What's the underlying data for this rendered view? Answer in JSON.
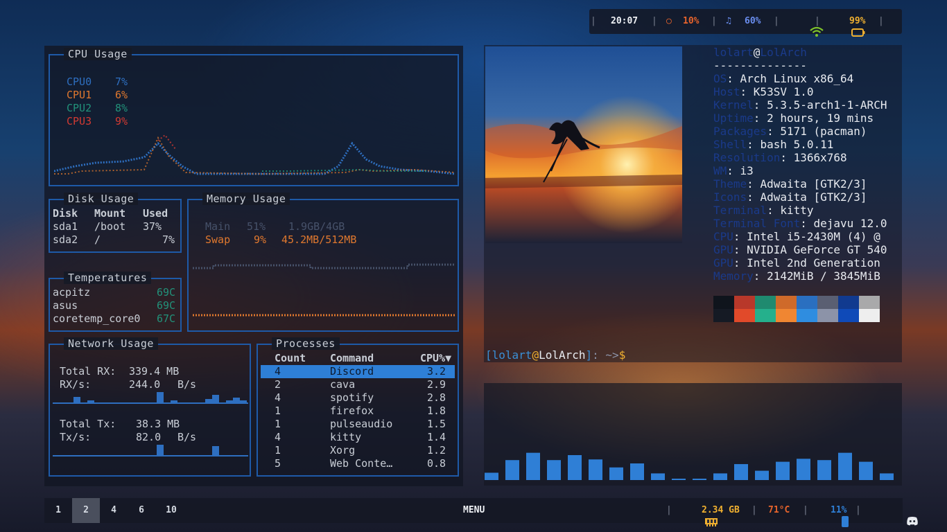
{
  "topbar": {
    "time": "20:07",
    "cpu": "10%",
    "volume": "60%",
    "battery": "99%",
    "sep": "|",
    "colors": {
      "cpu": "#e8642c",
      "volume": "#6a8ef0",
      "wifi": "#7ec32a",
      "battery": "#f0b030"
    }
  },
  "cpu": {
    "title": "CPU Usage",
    "cores": [
      {
        "name": "CPU0",
        "value": "7%",
        "color": "#2e6fc0"
      },
      {
        "name": "CPU1",
        "value": "6%",
        "color": "#e0782e"
      },
      {
        "name": "CPU2",
        "value": "8%",
        "color": "#22927a"
      },
      {
        "name": "CPU3",
        "value": "9%",
        "color": "#d23a32"
      }
    ]
  },
  "disk": {
    "title": "Disk Usage",
    "headers": [
      "Disk",
      "Mount",
      "Used"
    ],
    "rows": [
      [
        "sda1",
        "/boot",
        "37%"
      ],
      [
        "sda2",
        "/",
        "7%"
      ]
    ]
  },
  "temps": {
    "title": "Temperatures",
    "rows": [
      {
        "name": "acpitz",
        "value": "69C"
      },
      {
        "name": "asus",
        "value": "69C"
      },
      {
        "name": "coretemp_core0",
        "value": "67C"
      }
    ]
  },
  "memory": {
    "title": "Memory Usage",
    "main": {
      "label": "Main",
      "pct": "51%",
      "amount": "1.9GB/4GB"
    },
    "swap": {
      "label": "Swap",
      "pct": "9%",
      "amount": "45.2MB/512MB"
    },
    "colors": {
      "main": "#47526a",
      "swap": "#e0782e"
    }
  },
  "network": {
    "title": "Network Usage",
    "total_rx_label": "Total RX:",
    "total_rx": "339.4 MB",
    "rx_rate_label": "RX/s:",
    "rx_rate": "244.0",
    "rx_unit": "B/s",
    "total_tx_label": "Total Tx:",
    "total_tx": "38.3 MB",
    "tx_rate_label": "Tx/s:",
    "tx_rate": "82.0",
    "tx_unit": "B/s"
  },
  "processes": {
    "title": "Processes",
    "headers": {
      "count": "Count",
      "command": "Command",
      "cpu": "CPU%▼"
    },
    "rows": [
      {
        "count": "4",
        "command": "Discord",
        "cpu": "3.2"
      },
      {
        "count": "2",
        "command": "cava",
        "cpu": "2.9"
      },
      {
        "count": "4",
        "command": "spotify",
        "cpu": "2.8"
      },
      {
        "count": "1",
        "command": "firefox",
        "cpu": "1.8"
      },
      {
        "count": "1",
        "command": "pulseaudio",
        "cpu": "1.5"
      },
      {
        "count": "4",
        "command": "kitty",
        "cpu": "1.4"
      },
      {
        "count": "1",
        "command": "Xorg",
        "cpu": "1.2"
      },
      {
        "count": "5",
        "command": "Web Conte…",
        "cpu": "0.8"
      }
    ]
  },
  "neofetch": {
    "user": "lolart",
    "at": "@",
    "host": "LolArch",
    "divider": "--------------",
    "sep": ": ",
    "fields": [
      {
        "label": "OS",
        "value": "Arch Linux x86_64"
      },
      {
        "label": "Host",
        "value": "K53SV 1.0"
      },
      {
        "label": "Kernel",
        "value": "5.3.5-arch1-1-ARCH"
      },
      {
        "label": "Uptime",
        "value": "2 hours, 19 mins"
      },
      {
        "label": "Packages",
        "value": "5171 (pacman)"
      },
      {
        "label": "Shell",
        "value": "bash 5.0.11"
      },
      {
        "label": "Resolution",
        "value": "1366x768"
      },
      {
        "label": "WM",
        "value": "i3"
      },
      {
        "label": "Theme",
        "value": "Adwaita [GTK2/3]"
      },
      {
        "label": "Icons",
        "value": "Adwaita [GTK2/3]"
      },
      {
        "label": "Terminal",
        "value": "kitty"
      },
      {
        "label": "Terminal Font",
        "value": "dejavu 12.0"
      },
      {
        "label": "CPU",
        "value": "Intel i5-2430M (4) @"
      },
      {
        "label": "GPU",
        "value": "NVIDIA GeForce GT 540"
      },
      {
        "label": "GPU",
        "value": "Intel 2nd Generation"
      },
      {
        "label": "Memory",
        "value": "2142MiB / 3845MiB"
      }
    ],
    "palette_top": [
      "#0f141c",
      "#b8382a",
      "#1f8a6f",
      "#cf6a2a",
      "#2a6fc0",
      "#5a5f72",
      "#113a8f",
      "#a9a9aa"
    ],
    "palette_bottom": [
      "#151a24",
      "#e14a2a",
      "#25b08c",
      "#f08632",
      "#2f8de0",
      "#8c93a8",
      "#0f4ab8",
      "#eeeeee"
    ]
  },
  "prompt": {
    "open": "[",
    "user": "lolart",
    "at": "@",
    "host": "LolArch",
    "close": "]",
    "path": ": ~>",
    "symbol": "$"
  },
  "cava_levels": [
    0.22,
    0.6,
    0.82,
    0.6,
    0.75,
    0.62,
    0.38,
    0.5,
    0.2,
    0.04,
    0.04,
    0.2,
    0.48,
    0.28,
    0.55,
    0.64,
    0.6,
    0.82,
    0.55,
    0.2
  ],
  "bottombar": {
    "workspaces": [
      "1",
      "2",
      "4",
      "6",
      "10"
    ],
    "active_workspace": "2",
    "menu": "MENU",
    "memory": "2.34 GB",
    "temperature": "71°C",
    "brightness": "11%",
    "sep": "|",
    "colors": {
      "memory": "#f0b030",
      "temperature": "#e8642c",
      "brightness": "#2f7fd6"
    }
  }
}
